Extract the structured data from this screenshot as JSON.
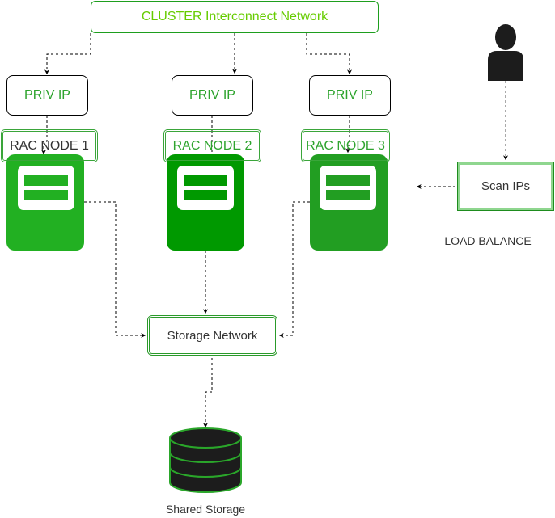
{
  "cluster": {
    "label": "CLUSTER Interconnect Network"
  },
  "nodes": [
    {
      "priv_ip": "PRIV IP",
      "rac_label": "RAC NODE 1",
      "color": "#22b022"
    },
    {
      "priv_ip": "PRIV IP",
      "rac_label": "RAC NODE 2",
      "color": "#009900"
    },
    {
      "priv_ip": "PRIV IP",
      "rac_label": "RAC NODE 3",
      "color": "#229e22"
    }
  ],
  "scan": {
    "label": "Scan IPs"
  },
  "load_balance": {
    "label": "LOAD  BALANCE"
  },
  "storage_network": {
    "label": "Storage Network"
  },
  "shared_storage": {
    "label": "Shared Storage"
  },
  "colors": {
    "cluster_text": "#66cc00",
    "node_text": "#2ea42e",
    "border_green": "#1e9e1e",
    "edge": "#000000",
    "storage_fill": "#1c1c1c"
  }
}
